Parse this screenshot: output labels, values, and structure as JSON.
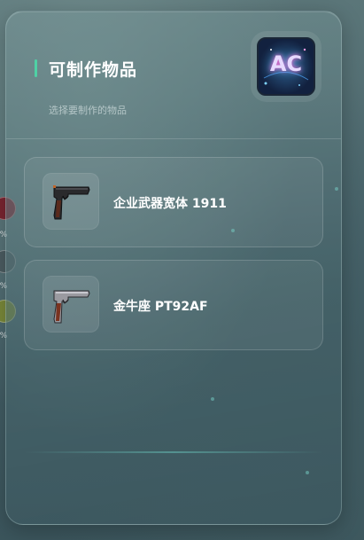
{
  "edge_badges": [
    {
      "icon": "badge-red-icon",
      "value": "0%"
    },
    {
      "icon": "badge-grey-icon",
      "value": "9%"
    },
    {
      "icon": "badge-olive-icon",
      "value": "3%"
    }
  ],
  "panel": {
    "title": "可制作物品",
    "subtitle": "选择要制作的物品",
    "app_icon": {
      "name": "ac-app-icon",
      "text": "AC"
    }
  },
  "items": [
    {
      "label": "企业武器宽体 1911",
      "icon": "pistol-1911-icon"
    },
    {
      "label": "金牛座 PT92AF",
      "icon": "pistol-pt92af-icon"
    }
  ],
  "colors": {
    "accent": "#4fd1a5",
    "text": "#ffffff",
    "subtext": "rgba(230,240,240,0.6)"
  }
}
